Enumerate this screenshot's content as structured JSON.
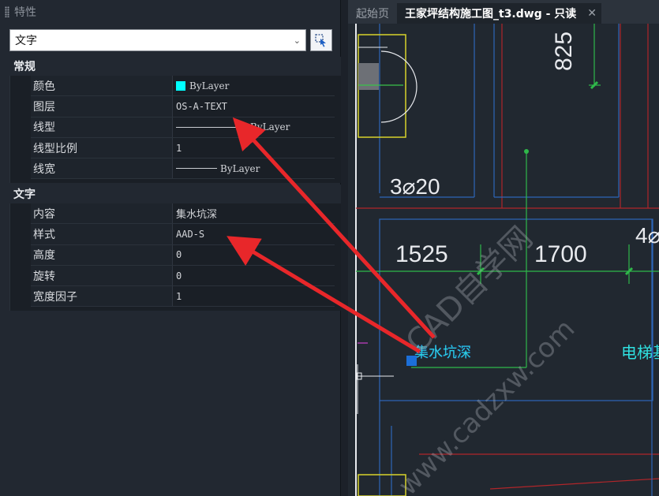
{
  "panel": {
    "title": "特性",
    "object_type": "文字",
    "sections": [
      {
        "header": "常规",
        "rows": [
          {
            "name": "颜色",
            "value": "ByLayer"
          },
          {
            "name": "图层",
            "value": "OS-A-TEXT"
          },
          {
            "name": "线型",
            "value": "ByLayer"
          },
          {
            "name": "线型比例",
            "value": "1"
          },
          {
            "name": "线宽",
            "value": "ByLayer"
          }
        ]
      },
      {
        "header": "文字",
        "rows": [
          {
            "name": "内容",
            "value": "集水坑深"
          },
          {
            "name": "样式",
            "value": "AAD-S"
          },
          {
            "name": "高度",
            "value": "0"
          },
          {
            "name": "旋转",
            "value": "0"
          },
          {
            "name": "宽度因子",
            "value": "1"
          }
        ]
      }
    ],
    "colors": {
      "layer_swatch": "#00ffff",
      "annotation_arrow": "#e8272a"
    }
  },
  "drawing": {
    "tabs": [
      {
        "label": "起始页"
      },
      {
        "label": "王家坪结构施工图_t3.dwg - 只读"
      }
    ],
    "dimensions": [
      "825",
      "1525",
      "1700"
    ],
    "rebar_labels": [
      "3⌀20",
      "4⌀"
    ],
    "elevator_text": "电梯基",
    "selected_text": "集水坑深",
    "watermark": [
      "CAD自学网",
      "www.cadzxw.com"
    ]
  }
}
